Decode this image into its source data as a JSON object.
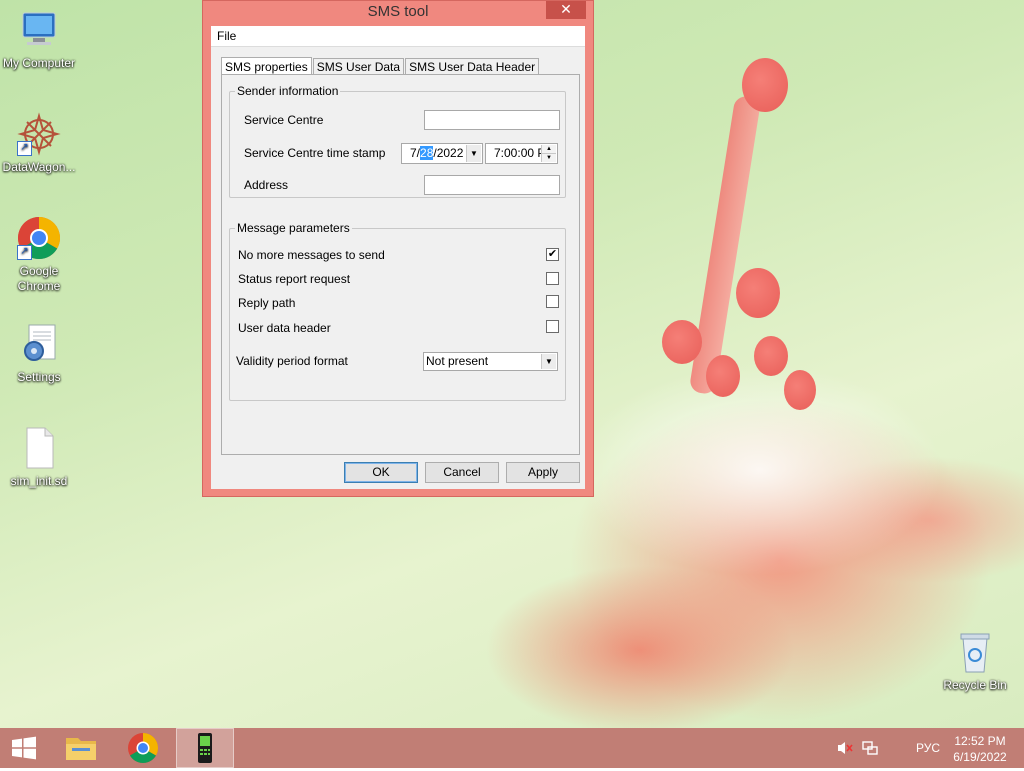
{
  "window": {
    "title": "SMS tool",
    "close_label": "✕",
    "menu": [
      "File"
    ],
    "tabs": [
      "SMS properties",
      "SMS User Data",
      "SMS User Data Header"
    ],
    "sender": {
      "legend": "Sender information",
      "service_centre_label": "Service Centre",
      "service_centre_value": "",
      "timestamp_label": "Service Centre time stamp",
      "date_month": "7/",
      "date_day": "28",
      "date_year": "/2022",
      "time_value": "7:00:00 P",
      "address_label": "Address",
      "address_value": ""
    },
    "params": {
      "legend": "Message parameters",
      "items": [
        {
          "label": "No more messages to send",
          "checked": true
        },
        {
          "label": "Status report request",
          "checked": false
        },
        {
          "label": "Reply path",
          "checked": false
        },
        {
          "label": "User data header",
          "checked": false
        }
      ],
      "validity_label": "Validity period format",
      "validity_value": "Not present"
    },
    "buttons": {
      "ok": "OK",
      "cancel": "Cancel",
      "apply": "Apply"
    }
  },
  "desktop_icons": [
    {
      "label": "My Computer",
      "icon": "computer-icon"
    },
    {
      "label": "DataWagon...",
      "icon": "datawagon-icon"
    },
    {
      "label": "Google Chrome",
      "icon": "chrome-icon"
    },
    {
      "label": "Settings",
      "icon": "settings-icon"
    },
    {
      "label": "sim_init.sd",
      "icon": "file-icon"
    },
    {
      "label": "Recycle Bin",
      "icon": "recycle-bin-icon"
    }
  ],
  "taskbar": {
    "language": "РУС",
    "time": "12:52 PM",
    "date": "6/19/2022"
  },
  "colors": {
    "window_frame": "#f0887f",
    "close_button": "#c7514a",
    "taskbar": "#c17e75",
    "selection": "#3399ff"
  }
}
